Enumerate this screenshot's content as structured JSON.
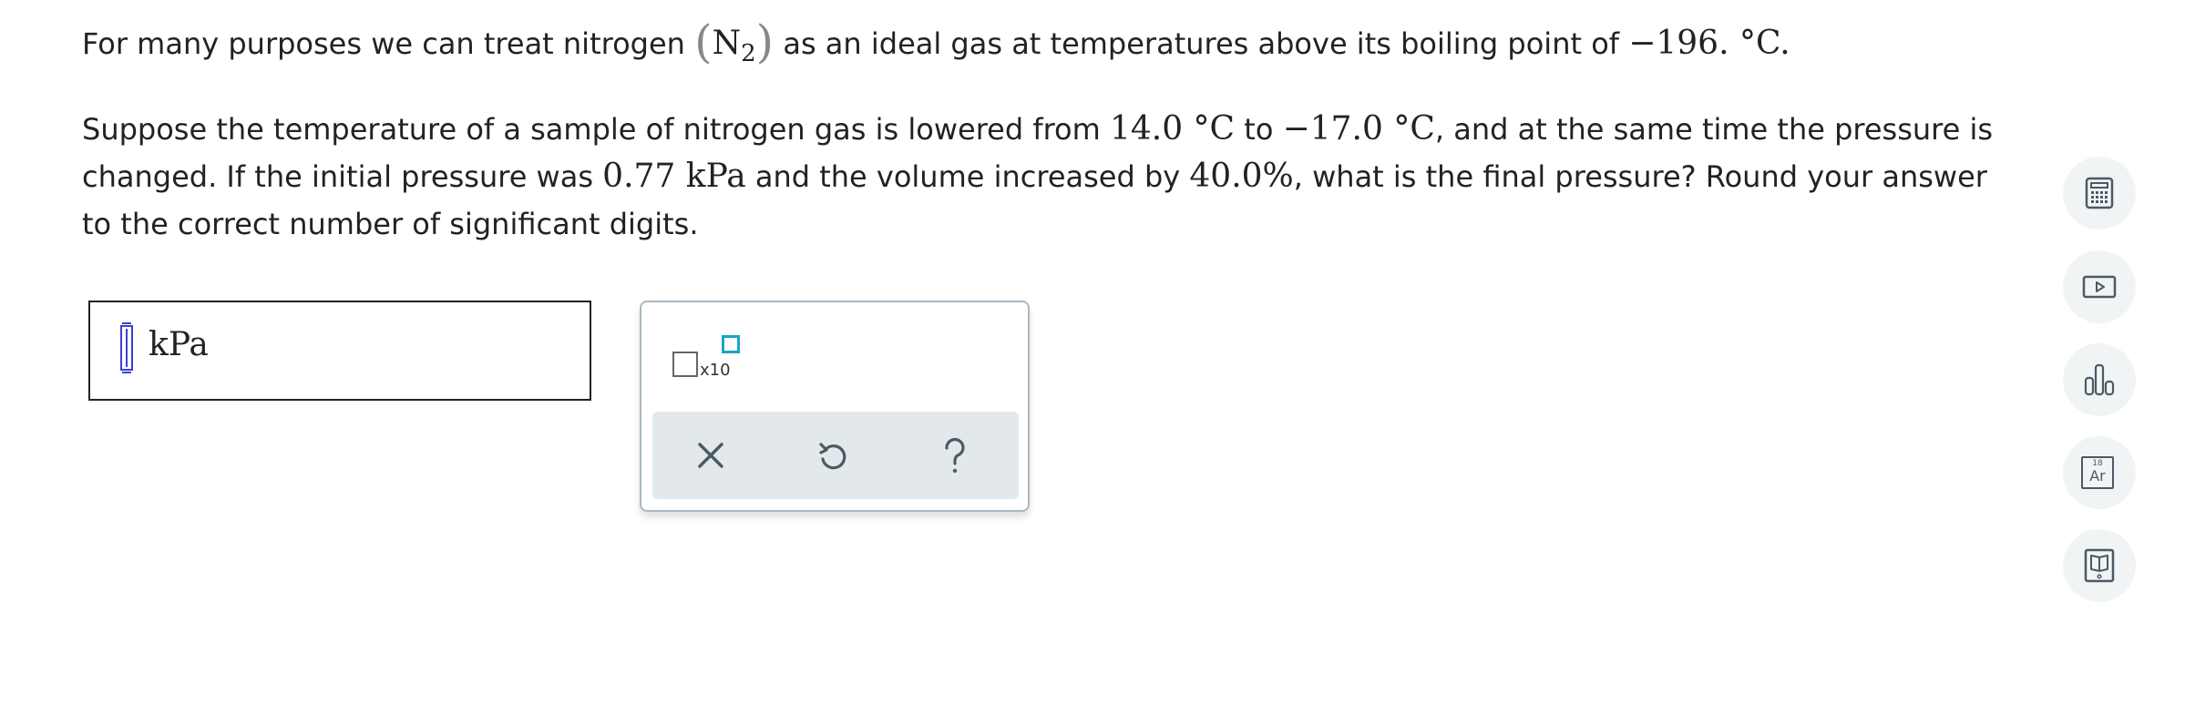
{
  "question": {
    "p1": {
      "before": "For many purposes we can treat nitrogen ",
      "formula_element": "N",
      "formula_subscript": "2",
      "middle": " as an ideal gas at temperatures above its boiling point of ",
      "boiling_point": "−196. °C",
      "end": "."
    },
    "p2": {
      "t1": "Suppose the temperature of a sample of nitrogen gas is lowered from ",
      "temp_initial": "14.0 °C",
      "t2": " to ",
      "temp_final": "−17.0 °C",
      "t3": ", and at the same time the pressure is changed. If the initial pressure was ",
      "pressure_initial": "0.77 kPa",
      "t4": " and the volume increased by ",
      "volume_change": "40.0%",
      "t5": ", what is the final pressure? Round your answer to the correct number of significant digits."
    }
  },
  "answer": {
    "value": "",
    "unit": "kPa"
  },
  "palette": {
    "sci_notation_label": "x10",
    "actions": {
      "clear": "clear",
      "undo": "undo",
      "help": "?"
    }
  },
  "tools": [
    {
      "name": "calculator",
      "icon": "calculator-icon"
    },
    {
      "name": "video",
      "icon": "video-play-icon"
    },
    {
      "name": "data",
      "icon": "bar-chart-icon"
    },
    {
      "name": "periodic-table",
      "icon": "periodic-table-icon",
      "number": "18",
      "symbol": "Ar"
    },
    {
      "name": "reference",
      "icon": "book-icon"
    }
  ],
  "colors": {
    "text": "#222222",
    "cursor": "#3f3fd6",
    "exponent_box": "#1aa3c9",
    "palette_border": "#a9b8c3",
    "action_bar": "#e3e9eb",
    "icon": "#4a5a66",
    "tool_bg": "#f1f4f5"
  }
}
